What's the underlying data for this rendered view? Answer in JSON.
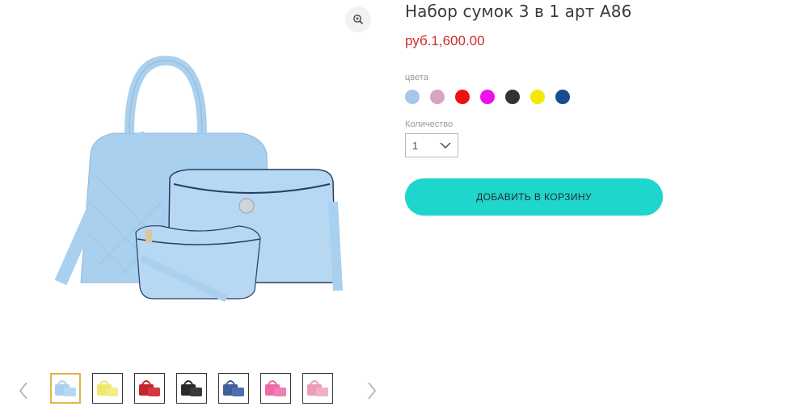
{
  "product": {
    "title": "Набор сумок 3 в 1 арт А86",
    "price": "руб.1,600.00"
  },
  "options": {
    "color_label": "цвета",
    "colors": [
      "#a5c8ea",
      "#d8a5c0",
      "#ee1111",
      "#ee11ee",
      "#333333",
      "#f2ea00",
      "#174d92"
    ],
    "quantity_label": "Количество",
    "quantity_value": "1"
  },
  "actions": {
    "add_to_cart": "ДОБАВИТЬ В КОРЗИНУ"
  },
  "gallery": {
    "thumbnail_colors": [
      "#a9d0ee",
      "#f0e86a",
      "#c2272d",
      "#2a2a2a",
      "#3e5f9c",
      "#ee6aa8",
      "#ea9db7"
    ],
    "main_image_color": "#a9d0ee"
  }
}
